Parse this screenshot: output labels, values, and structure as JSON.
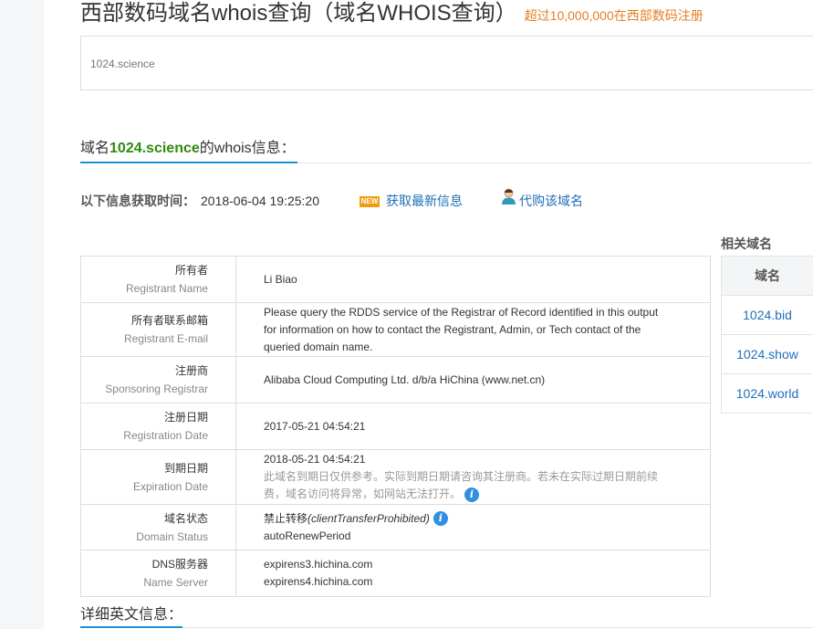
{
  "header": {
    "title": "西部数码域名whois查询（域名WHOIS查询）",
    "subtitle": "超过10,000,000在西部数码注册"
  },
  "search": {
    "placeholder": "1024.science"
  },
  "whois_section": {
    "prefix": "域名",
    "domain": "1024.science",
    "suffix": "的whois信息："
  },
  "fetch": {
    "label": "以下信息获取时间：",
    "time": "2018-06-04 19:25:20",
    "new_badge": "NEW",
    "refresh_label": "获取最新信息",
    "buy_label": "代购该域名"
  },
  "whois_rows": [
    {
      "cn": "所有者",
      "en": "Registrant Name",
      "value": "Li Biao"
    },
    {
      "cn": "所有者联系邮箱",
      "en": "Registrant E-mail",
      "value": "Please query the RDDS service of the Registrar of Record identified in this output for information on how to contact the Registrant, Admin, or Tech contact of the queried domain name."
    },
    {
      "cn": "注册商",
      "en": "Sponsoring Registrar",
      "value": "Alibaba Cloud Computing Ltd. d/b/a HiChina (www.net.cn)"
    },
    {
      "cn": "注册日期",
      "en": "Registration Date",
      "value": "2017-05-21 04:54:21"
    },
    {
      "cn": "到期日期",
      "en": "Expiration Date",
      "value": "2018-05-21 04:54:21",
      "note": "此域名到期日仅供参考。实际到期日期请咨询其注册商。若未在实际过期日期前续费，域名访问将异常，如网站无法打开。"
    },
    {
      "cn": "域名状态",
      "en": "Domain Status",
      "status_cn": "禁止转移",
      "status_code": "(clientTransferProhibited)",
      "status2": "autoRenewPeriod"
    },
    {
      "cn": "DNS服务器",
      "en": "Name Server",
      "ns1": "expirens3.hichina.com",
      "ns2": "expirens4.hichina.com"
    }
  ],
  "details_section": {
    "title": "详细英文信息："
  },
  "related": {
    "title": "相关域名",
    "header": "域名",
    "domains": [
      "1024.bid",
      "1024.show",
      "1024.world"
    ]
  },
  "colors": {
    "accent": "#1e8fd4",
    "domain_green": "#2e8b0e",
    "orange": "#e67e22",
    "link": "#1e6fb8"
  }
}
